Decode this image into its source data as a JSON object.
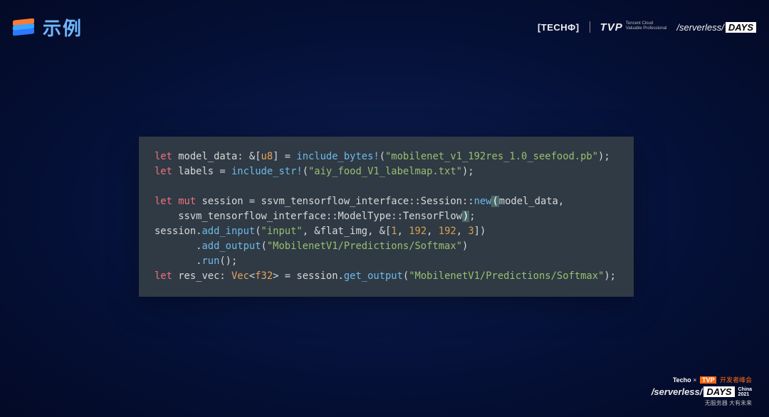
{
  "header": {
    "title": "示例",
    "brands": {
      "techo": "[TECHФ]",
      "tvp": {
        "big": "TVP",
        "line1": "Tencent Cloud",
        "line2": "Valuable Professional"
      },
      "serverless_days": {
        "slash": "/serverless/",
        "days": "DAYS"
      }
    }
  },
  "code": {
    "lines": [
      [
        {
          "cls": "kw",
          "t": "let"
        },
        {
          "t": " model_data: "
        },
        {
          "cls": "punc",
          "t": "&["
        },
        {
          "cls": "typ",
          "t": "u8"
        },
        {
          "cls": "punc",
          "t": "]"
        },
        {
          "t": " = "
        },
        {
          "cls": "call",
          "t": "include_bytes!"
        },
        {
          "cls": "punc",
          "t": "("
        },
        {
          "cls": "str",
          "t": "\"mobilenet_v1_192res_1.0_seefood.pb\""
        },
        {
          "cls": "punc",
          "t": ");"
        }
      ],
      [
        {
          "cls": "kw",
          "t": "let"
        },
        {
          "t": " labels = "
        },
        {
          "cls": "call",
          "t": "include_str!"
        },
        {
          "cls": "punc",
          "t": "("
        },
        {
          "cls": "str",
          "t": "\"aiy_food_V1_labelmap.txt\""
        },
        {
          "cls": "punc",
          "t": ");"
        }
      ],
      [
        {
          "t": ""
        }
      ],
      [
        {
          "cls": "kw",
          "t": "let"
        },
        {
          "t": " "
        },
        {
          "cls": "kw",
          "t": "mut"
        },
        {
          "t": " session = ssvm_tensorflow_interface::Session::"
        },
        {
          "cls": "call",
          "t": "new"
        },
        {
          "cls": "cursor-hl",
          "t": "("
        },
        {
          "t": "model_data,"
        }
      ],
      [
        {
          "t": "    ssvm_tensorflow_interface::ModelType::TensorFlow"
        },
        {
          "cls": "cursor-hl",
          "t": ")"
        },
        {
          "cls": "punc",
          "t": ";"
        }
      ],
      [
        {
          "t": "session."
        },
        {
          "cls": "call",
          "t": "add_input"
        },
        {
          "cls": "punc",
          "t": "("
        },
        {
          "cls": "str",
          "t": "\"input\""
        },
        {
          "cls": "punc",
          "t": ", &"
        },
        {
          "t": "flat_img"
        },
        {
          "cls": "punc",
          "t": ", &["
        },
        {
          "cls": "num",
          "t": "1"
        },
        {
          "cls": "punc",
          "t": ", "
        },
        {
          "cls": "num",
          "t": "192"
        },
        {
          "cls": "punc",
          "t": ", "
        },
        {
          "cls": "num",
          "t": "192"
        },
        {
          "cls": "punc",
          "t": ", "
        },
        {
          "cls": "num",
          "t": "3"
        },
        {
          "cls": "punc",
          "t": "])"
        }
      ],
      [
        {
          "t": "       ."
        },
        {
          "cls": "call",
          "t": "add_output"
        },
        {
          "cls": "punc",
          "t": "("
        },
        {
          "cls": "str",
          "t": "\"MobilenetV1/Predictions/Softmax\""
        },
        {
          "cls": "punc",
          "t": ")"
        }
      ],
      [
        {
          "t": "       ."
        },
        {
          "cls": "call",
          "t": "run"
        },
        {
          "cls": "punc",
          "t": "();"
        }
      ],
      [
        {
          "cls": "kw",
          "t": "let"
        },
        {
          "t": " res_vec: "
        },
        {
          "cls": "typ",
          "t": "Vec"
        },
        {
          "cls": "punc",
          "t": "<"
        },
        {
          "cls": "typ",
          "t": "f32"
        },
        {
          "cls": "punc",
          "t": ">"
        },
        {
          "t": " = session."
        },
        {
          "cls": "call",
          "t": "get_output"
        },
        {
          "cls": "punc",
          "t": "("
        },
        {
          "cls": "str",
          "t": "\"MobilenetV1/Predictions/Softmax\""
        },
        {
          "cls": "punc",
          "t": ");"
        }
      ]
    ]
  },
  "footer": {
    "top": {
      "techo": "Techo",
      "x": "×",
      "tvp": "TVP",
      "dev": "开发者峰会"
    },
    "mid": {
      "slash": "/serverless/",
      "days": "DAYS",
      "china_l1": "China",
      "china_l2": "2021"
    },
    "bot": "无服务器 大有未来"
  }
}
